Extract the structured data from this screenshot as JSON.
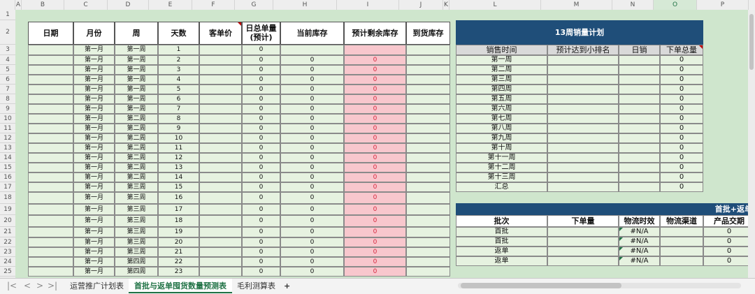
{
  "column_headers": [
    "A",
    "B",
    "C",
    "D",
    "E",
    "F",
    "G",
    "H",
    "I",
    "J",
    "K",
    "L",
    "M",
    "N",
    "O",
    "P"
  ],
  "selected_column": "O",
  "row_numbers": [
    "1",
    "2",
    "3",
    "4",
    "5",
    "6",
    "7",
    "8",
    "9",
    "10",
    "11",
    "12",
    "13",
    "14",
    "15",
    "16",
    "17",
    "18",
    "19",
    "20",
    "21",
    "22",
    "23",
    "24",
    "25"
  ],
  "left_table": {
    "headers": {
      "date": "日期",
      "month": "月份",
      "week": "周",
      "days": "天数",
      "unit_price": "客单价",
      "daily_orders_line1": "日总单量",
      "daily_orders_line2": "(预计)",
      "current_stock": "当前库存",
      "expected_remaining": "预计剩余库存",
      "arrival_stock": "到货库存"
    },
    "rows": [
      {
        "month": "第一月",
        "week": "第一周",
        "days": "1",
        "orders": "0",
        "stock": "",
        "remaining": ""
      },
      {
        "month": "第一月",
        "week": "第一周",
        "days": "2",
        "orders": "0",
        "stock": "0",
        "remaining": "0"
      },
      {
        "month": "第一月",
        "week": "第一周",
        "days": "3",
        "orders": "0",
        "stock": "0",
        "remaining": "0"
      },
      {
        "month": "第一月",
        "week": "第一周",
        "days": "4",
        "orders": "0",
        "stock": "0",
        "remaining": "0"
      },
      {
        "month": "第一月",
        "week": "第一周",
        "days": "5",
        "orders": "0",
        "stock": "0",
        "remaining": "0"
      },
      {
        "month": "第一月",
        "week": "第一周",
        "days": "6",
        "orders": "0",
        "stock": "0",
        "remaining": "0"
      },
      {
        "month": "第一月",
        "week": "第一周",
        "days": "7",
        "orders": "0",
        "stock": "0",
        "remaining": "0"
      },
      {
        "month": "第一月",
        "week": "第二周",
        "days": "8",
        "orders": "0",
        "stock": "0",
        "remaining": "0"
      },
      {
        "month": "第一月",
        "week": "第二周",
        "days": "9",
        "orders": "0",
        "stock": "0",
        "remaining": "0"
      },
      {
        "month": "第一月",
        "week": "第二周",
        "days": "10",
        "orders": "0",
        "stock": "0",
        "remaining": "0"
      },
      {
        "month": "第一月",
        "week": "第二周",
        "days": "11",
        "orders": "0",
        "stock": "0",
        "remaining": "0"
      },
      {
        "month": "第一月",
        "week": "第二周",
        "days": "12",
        "orders": "0",
        "stock": "0",
        "remaining": "0"
      },
      {
        "month": "第一月",
        "week": "第二周",
        "days": "13",
        "orders": "0",
        "stock": "0",
        "remaining": "0"
      },
      {
        "month": "第一月",
        "week": "第二周",
        "days": "14",
        "orders": "0",
        "stock": "0",
        "remaining": "0"
      },
      {
        "month": "第一月",
        "week": "第三周",
        "days": "15",
        "orders": "0",
        "stock": "0",
        "remaining": "0"
      },
      {
        "month": "第一月",
        "week": "第三周",
        "days": "16",
        "orders": "0",
        "stock": "0",
        "remaining": "0"
      },
      {
        "month": "第一月",
        "week": "第三周",
        "days": "17",
        "orders": "0",
        "stock": "0",
        "remaining": "0"
      },
      {
        "month": "第一月",
        "week": "第三周",
        "days": "18",
        "orders": "0",
        "stock": "0",
        "remaining": "0"
      },
      {
        "month": "第一月",
        "week": "第三周",
        "days": "19",
        "orders": "0",
        "stock": "0",
        "remaining": "0"
      },
      {
        "month": "第一月",
        "week": "第三周",
        "days": "20",
        "orders": "0",
        "stock": "0",
        "remaining": "0"
      },
      {
        "month": "第一月",
        "week": "第三周",
        "days": "21",
        "orders": "0",
        "stock": "0",
        "remaining": "0"
      },
      {
        "month": "第一月",
        "week": "第四周",
        "days": "22",
        "orders": "0",
        "stock": "0",
        "remaining": "0"
      },
      {
        "month": "第一月",
        "week": "第四周",
        "days": "23",
        "orders": "0",
        "stock": "0",
        "remaining": "0"
      }
    ]
  },
  "sales_plan": {
    "title": "13周销量计划",
    "headers": {
      "time": "销售时间",
      "rank": "预计达到小排名",
      "daily": "日销",
      "total": "下单总量"
    },
    "rows": [
      {
        "week": "第一周",
        "total": "0"
      },
      {
        "week": "第二周",
        "total": "0"
      },
      {
        "week": "第三周",
        "total": "0"
      },
      {
        "week": "第四周",
        "total": "0"
      },
      {
        "week": "第五周",
        "total": "0"
      },
      {
        "week": "第六周",
        "total": "0"
      },
      {
        "week": "第七周",
        "total": "0"
      },
      {
        "week": "第八周",
        "total": "0"
      },
      {
        "week": "第九周",
        "total": "0"
      },
      {
        "week": "第十周",
        "total": "0"
      },
      {
        "week": "第十一周",
        "total": "0"
      },
      {
        "week": "第十二周",
        "total": "0"
      },
      {
        "week": "第十三周",
        "total": "0"
      },
      {
        "week": "汇总",
        "total": "0"
      }
    ]
  },
  "batch_table": {
    "title": "首批+返单",
    "headers": {
      "batch": "批次",
      "order_qty": "下单量",
      "logistics_time": "物流时效",
      "channel": "物流渠道",
      "delivery": "产品交期"
    },
    "rows": [
      {
        "batch": "首批",
        "logistics": "#N/A",
        "delivery": "0"
      },
      {
        "batch": "首批",
        "logistics": "#N/A",
        "delivery": "0"
      },
      {
        "batch": "返单",
        "logistics": "#N/A",
        "delivery": "0"
      },
      {
        "batch": "返单",
        "logistics": "#N/A",
        "delivery": "0"
      }
    ]
  },
  "tabs": {
    "items": [
      "运营推广计划表",
      "首批与返单囤货数量预测表",
      "毛利测算表"
    ],
    "active_index": 1,
    "add_label": "+"
  },
  "nav_glyphs": {
    "first": "|<",
    "prev": "<",
    "next": ">",
    "last": ">|"
  }
}
